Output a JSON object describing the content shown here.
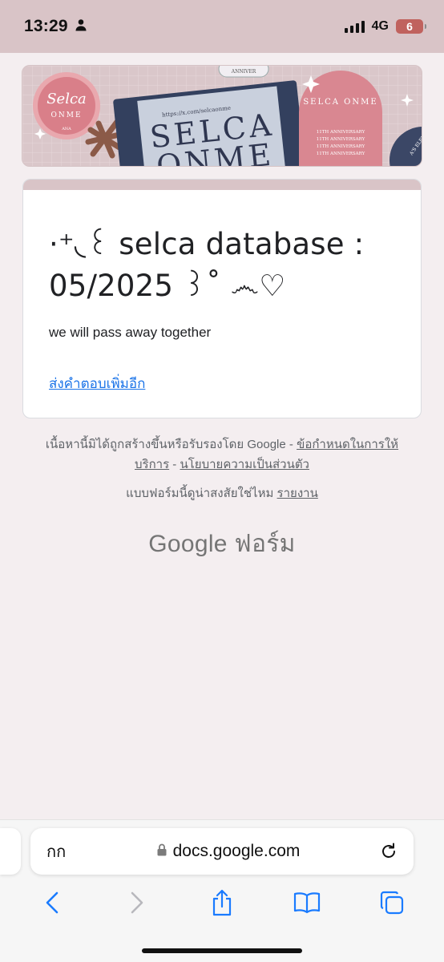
{
  "status_bar": {
    "time": "13:29",
    "network": "4G",
    "battery_level": "6"
  },
  "banner": {
    "logo_text_1": "Selca",
    "logo_text_2": "ONME",
    "logo_small": "ANA",
    "center_text_1": "SELCA",
    "center_text_2": "ONME",
    "url_strip": "https://x.com/selcaonme",
    "badge_title": "SELCA ONME",
    "anniversary_line": "11TH ANNIVERSARY",
    "top_tag": "ANNIVER",
    "edge_text": "A'S ELEVENTH"
  },
  "form": {
    "title": "·⁺◟꒰ selca database : 05/2025 ꒱˚ ෴♡",
    "description": "we will pass away together",
    "submit_another_link": "ส่งคำตอบเพิ่มอีก"
  },
  "footer": {
    "disclaimer": "เนื้อหานี้มิได้ถูกสร้างขึ้นหรือรับรองโดย Google - ",
    "terms_link": "ข้อกำหนดในการให้บริการ",
    "separator": " - ",
    "privacy_link": "นโยบายความเป็นส่วนตัว",
    "report_question": "แบบฟอร์มนี้ดูน่าสงสัยใช่ไหม ",
    "report_link": "รายงาน",
    "logo_google": "Google",
    "logo_forms": " ฟอร์ม"
  },
  "browser": {
    "text_size_label": "กก",
    "url": "docs.google.com"
  },
  "icons": {
    "person": "person-icon",
    "lock": "lock-icon",
    "reload": "reload-icon",
    "back": "back-icon",
    "forward": "forward-icon",
    "share": "share-icon",
    "bookmarks": "bookmarks-icon",
    "tabs": "tabs-icon"
  },
  "colors": {
    "theme": "#d9c4c7",
    "page_background": "#f4eef0",
    "link": "#1a73e8",
    "ios_blue": "#1a7bff"
  }
}
